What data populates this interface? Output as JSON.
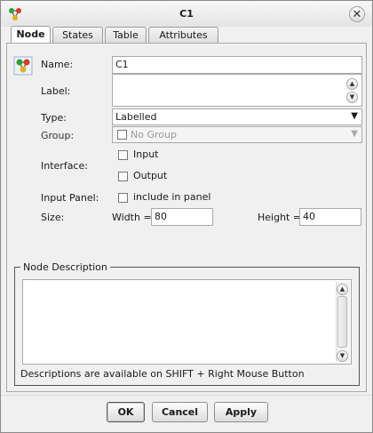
{
  "window": {
    "title": "C1"
  },
  "tabs": [
    {
      "label": "Node",
      "active": true
    },
    {
      "label": "States",
      "active": false
    },
    {
      "label": "Table",
      "active": false
    },
    {
      "label": "Attributes",
      "active": false
    }
  ],
  "form": {
    "name_label": "Name:",
    "name_value": "C1",
    "label_label": "Label:",
    "label_value": "",
    "type_label": "Type:",
    "type_value": "Labelled",
    "group_label": "Group:",
    "group_value": "No Group",
    "interface_label": "Interface:",
    "input_option": "Input",
    "output_option": "Output",
    "input_panel_label": "Input Panel:",
    "include_option": "include in panel",
    "size_label": "Size:",
    "width_label": "Width =",
    "width_value": "80",
    "height_label": "Height =",
    "height_value": "40"
  },
  "description": {
    "legend": "Node Description",
    "text": "",
    "hint": "Descriptions are available on SHIFT + Right Mouse Button"
  },
  "buttons": {
    "ok": "OK",
    "cancel": "Cancel",
    "apply": "Apply"
  },
  "icons": {
    "app": "network-nodes-icon",
    "close": "close-icon",
    "node": "node-network-icon"
  }
}
